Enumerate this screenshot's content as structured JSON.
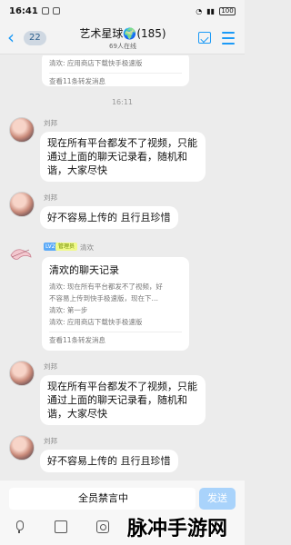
{
  "status_bar": {
    "time": "16:41",
    "battery": "100"
  },
  "header": {
    "back_icon": "chevron-left-icon",
    "unread_count": "22",
    "title": "艺术星球🌍(185)",
    "subtitle": "69人在线",
    "icons": [
      "calendar-check-icon",
      "menu-icon"
    ]
  },
  "messages": {
    "top_card": {
      "line": "清欢: 应用商店下载快手极速版",
      "footer": "查看11条转发消息"
    },
    "time_divider": "16:11",
    "msg1": {
      "sender": "刘邦",
      "text": "现在所有平台都发不了视频，只能通过上面的聊天记录看，随机和谐，大家尽快"
    },
    "msg2": {
      "sender": "刘邦",
      "text": "好不容易上传的 且行且珍惜"
    },
    "msg3": {
      "level": "LV2",
      "role": "管理员",
      "sender": "清欢",
      "card_title": "清欢的聊天记录",
      "card_lines": [
        "清欢: 现在所有平台都发不了视频，好",
        "不容易上传到快手极速版，现在下…",
        "清欢: 第一步",
        "清欢: 应用商店下载快手极速版"
      ],
      "footer": "查看11条转发消息"
    },
    "msg4": {
      "sender": "刘邦",
      "text": "现在所有平台都发不了视频，只能通过上面的聊天记录看，随机和谐，大家尽快"
    },
    "msg5": {
      "sender": "刘邦",
      "text": "好不容易上传的 且行且珍惜"
    }
  },
  "input": {
    "placeholder": "全员禁言中",
    "send_label": "发送"
  },
  "toolbar": {
    "icons": [
      "microphone-icon",
      "image-icon",
      "camera-icon"
    ]
  },
  "watermark": "脉冲手游网",
  "colors": {
    "accent": "#1b9af7",
    "send_disabled": "#a9d3fb",
    "background": "#ececec"
  }
}
